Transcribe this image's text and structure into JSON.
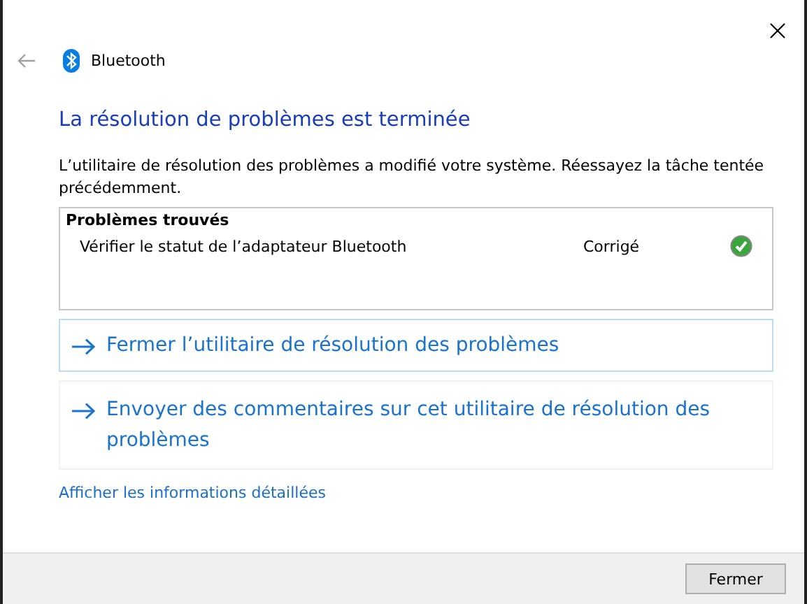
{
  "header": {
    "title": "Bluetooth"
  },
  "heading": "La résolution de problèmes est terminée",
  "message": "L’utilitaire de résolution des problèmes a modifié votre système. Réessayez la tâche tentée précédemment.",
  "problems": {
    "title": "Problèmes trouvés",
    "rows": [
      {
        "name": "Vérifier le statut de l’adaptateur Bluetooth",
        "status": "Corrigé",
        "fixed": true
      }
    ]
  },
  "commands": [
    {
      "label": "Fermer l’utilitaire de résolution des problèmes",
      "selected": true
    },
    {
      "label": "Envoyer des commentaires sur cet utilitaire de résolution des problèmes",
      "selected": false
    }
  ],
  "details_link": "Afficher les informations détaillées",
  "buttons": [
    "Fermer"
  ]
}
